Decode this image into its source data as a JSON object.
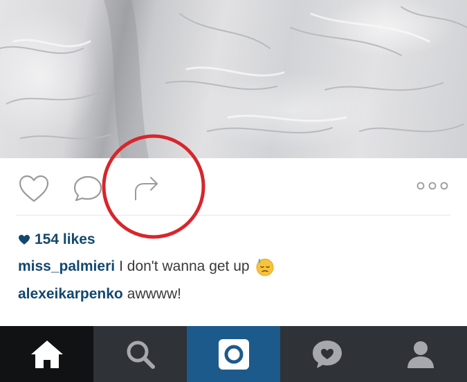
{
  "post": {
    "likes_text": "154 likes",
    "comments": [
      {
        "username": "miss_palmieri",
        "text": "I don't wanna get up",
        "emoji": "sleepy-sweat-emoji"
      },
      {
        "username": "alexeikarpenko",
        "text": "awwww!"
      }
    ]
  },
  "action_bar": {
    "icons": [
      "heart-icon",
      "comment-icon",
      "share-icon",
      "more-icon"
    ]
  },
  "annotation": {
    "shape": "circle",
    "color": "#d7262c",
    "target": "share-icon"
  },
  "tab_bar": {
    "items": [
      "home-icon",
      "search-icon",
      "camera-icon",
      "activity-icon",
      "profile-icon"
    ],
    "selected": "camera-icon"
  },
  "colors": {
    "link_blue": "#12476f",
    "annotation_red": "#d7262c",
    "tab_dark": "#2f3237",
    "tab_camera": "#1d5a8c"
  }
}
